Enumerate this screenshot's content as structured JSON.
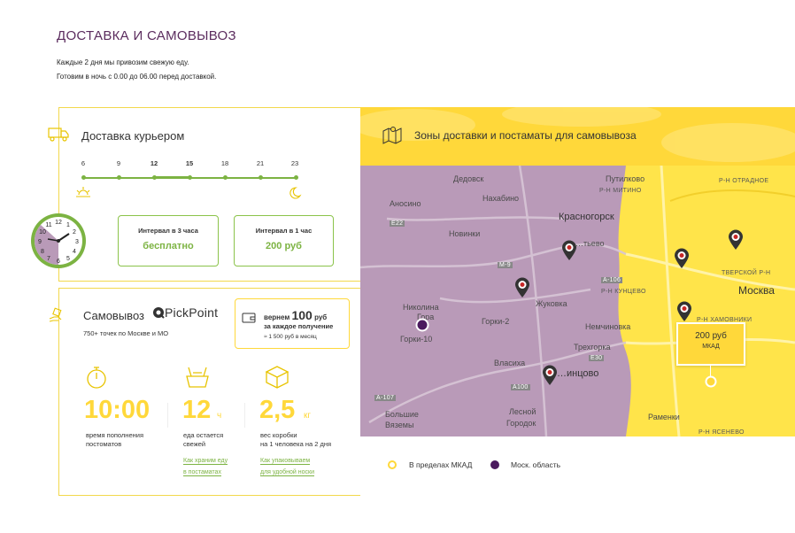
{
  "page": {
    "title": "ДОСТАВКА И САМОВЫВОЗ",
    "subtitle_line1": "Каждые 2 дня мы привозим свежую еду.",
    "subtitle_line2": "Готовим в ночь с 0.00 до 06.00 перед доставкой."
  },
  "courier": {
    "heading": "Доставка курьером",
    "hours": [
      "6",
      "9",
      "12",
      "15",
      "18",
      "21",
      "23"
    ],
    "interval3_title": "Интервал в 3 часа",
    "interval3_price": "бесплатно",
    "interval1_title": "Интервал в 1 час",
    "interval1_price": "200 руб"
  },
  "pickup": {
    "heading": "Самовывоз",
    "brand": "PickPoint",
    "points": "750+ точек по Москве и МО",
    "refund_prefix": "вернем",
    "refund_amount": "100",
    "refund_unit": "руб",
    "refund_line2": "за каждое получение",
    "refund_note": "≈ 1 500 руб в месяц",
    "stats": [
      {
        "value": "10:00",
        "unit": "",
        "desc1": "время пополнения",
        "desc2": "постоматов",
        "link1": "",
        "link2": ""
      },
      {
        "value": "12",
        "unit": "ч",
        "desc1": "еда остается",
        "desc2": "свежей",
        "link1": "Как храним еду",
        "link2": "в постаматах"
      },
      {
        "value": "2,5",
        "unit": "кг",
        "desc1": "вес коробки",
        "desc2": "на 1 человека на 2 дня",
        "link1": "Как упаковываем",
        "link2": "для удобной носки"
      }
    ]
  },
  "map": {
    "heading": "Зоны доставки и постаматы для самовывоза",
    "labels": {
      "dedovsk": "Дедовск",
      "nakhabino": "Нахабино",
      "putilkovo": "Путилково",
      "mitino": "Р-Н МИТИНО",
      "otradnoe": "Р-Н ОТРАДНОЕ",
      "anosino": "Аносино",
      "krasnogorsk": "Красногорск",
      "e22": "E22",
      "novinki": "Новинки",
      "tushino": "…тьево",
      "m9": "М-9",
      "a106": "А-106",
      "kuntsevo": "Р-Н КУНЦЕВО",
      "tverskoy": "ТВЕРСКОЙ Р-Н",
      "moscow": "Москва",
      "nikolina": "Николина",
      "gora": "Гора",
      "zhukovka": "Жуковка",
      "gorki2": "Горки-2",
      "khamovniki": "Р-Н ХАМОВНИКИ",
      "gorki10": "Горки-10",
      "nemchinovka": "Немчиновка",
      "trekhgorka": "Трехгорка",
      "e30": "E30",
      "vlasikha": "Власиха",
      "odintsovo": "…инцово",
      "a100": "А100",
      "a107": "А-107",
      "bolshie": "Большие",
      "vyazemy": "Вяземы",
      "lesnoy": "Лесной",
      "gorodok": "Городок",
      "ramenki": "Раменки",
      "yasenevo": "Р-Н ЯСЕНЕВО"
    },
    "tooltip_price": "200 руб",
    "tooltip_label": "МКАД"
  },
  "legend": {
    "inside_mkad": "В пределах МКАД",
    "region": "Моск. область"
  },
  "colors": {
    "accent_yellow": "#ffd83a",
    "purple": "#4b1a5e",
    "green": "#7cb342",
    "region_fill": "#b99ab8"
  }
}
